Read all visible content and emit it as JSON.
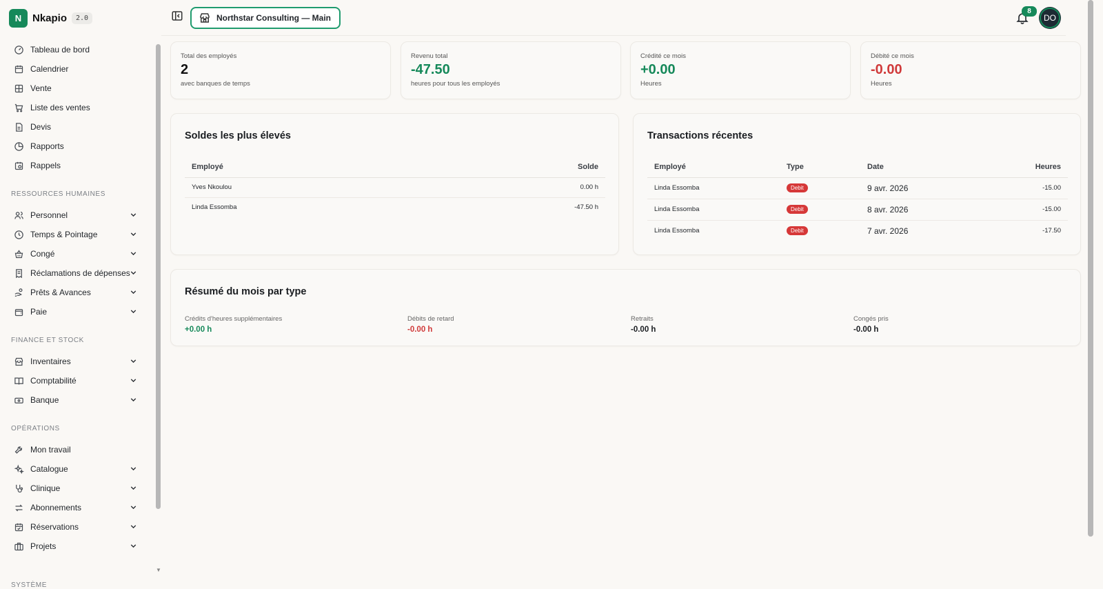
{
  "brand": {
    "logo_letter": "N",
    "name": "Nkapio",
    "version": "2.0"
  },
  "sidebar": {
    "top_items": [
      {
        "label": "Tableau de bord",
        "icon": "dashboard-gauge-icon"
      },
      {
        "label": "Calendrier",
        "icon": "calendar-icon"
      },
      {
        "label": "Vente",
        "icon": "grid-icon"
      },
      {
        "label": "Liste des ventes",
        "icon": "cart-icon"
      },
      {
        "label": "Devis",
        "icon": "document-icon"
      },
      {
        "label": "Rapports",
        "icon": "pie-chart-icon"
      },
      {
        "label": "Rappels",
        "icon": "calendar-clock-icon"
      }
    ],
    "sections": [
      {
        "title": "RESSOURCES HUMAINES",
        "items": [
          {
            "label": "Personnel",
            "icon": "users-icon"
          },
          {
            "label": "Temps & Pointage",
            "icon": "clock-icon"
          },
          {
            "label": "Congé",
            "icon": "beach-basket-icon"
          },
          {
            "label": "Réclamations de dépenses",
            "icon": "receipt-icon"
          },
          {
            "label": "Prêts & Avances",
            "icon": "hand-coins-icon"
          },
          {
            "label": "Paie",
            "icon": "wallet-icon"
          }
        ]
      },
      {
        "title": "FINANCE ET STOCK",
        "items": [
          {
            "label": "Inventaires",
            "icon": "store-icon"
          },
          {
            "label": "Comptabilité",
            "icon": "book-icon"
          },
          {
            "label": "Banque",
            "icon": "banknote-icon"
          }
        ]
      },
      {
        "title": "OPÉRATIONS",
        "items": [
          {
            "label": "Mon travail",
            "icon": "wrench-icon"
          },
          {
            "label": "Catalogue",
            "icon": "sparkles-icon"
          },
          {
            "label": "Clinique",
            "icon": "stethoscope-icon"
          },
          {
            "label": "Abonnements",
            "icon": "repeat-icon"
          },
          {
            "label": "Réservations",
            "icon": "calendar-check-icon"
          },
          {
            "label": "Projets",
            "icon": "briefcase-icon"
          }
        ]
      },
      {
        "title": "SYSTÈME",
        "items": []
      }
    ]
  },
  "header": {
    "store_name": "Northstar Consulting — Main",
    "notifications_count": "8",
    "avatar_initials": "DO"
  },
  "stats": [
    {
      "label": "Total des employés",
      "value": "2",
      "sub": "avec banques de temps",
      "color": "#111111"
    },
    {
      "label": "Revenu total",
      "value": "-47.50",
      "sub": "heures pour tous les employés",
      "color": "#16895a"
    },
    {
      "label": "Crédité ce mois",
      "value": "+0.00",
      "sub": "Heures",
      "color": "#16895a"
    },
    {
      "label": "Débité ce mois",
      "value": "-0.00",
      "sub": "Heures",
      "color": "#d03a3a"
    }
  ],
  "balances": {
    "title": "Soldes les plus élevés",
    "headers": {
      "employee": "Employé",
      "balance": "Solde"
    },
    "rows": [
      {
        "employee": "Yves Nkoulou",
        "balance": "0.00 h",
        "tone": "green"
      },
      {
        "employee": "Linda Essomba",
        "balance": "-47.50 h",
        "tone": "red"
      }
    ]
  },
  "transactions": {
    "title": "Transactions récentes",
    "headers": {
      "employee": "Employé",
      "type": "Type",
      "date": "Date",
      "hours": "Heures"
    },
    "rows": [
      {
        "employee": "Linda Essomba",
        "type": "Debit",
        "date": "9 avr. 2026",
        "hours": "-15.00"
      },
      {
        "employee": "Linda Essomba",
        "type": "Debit",
        "date": "8 avr. 2026",
        "hours": "-15.00"
      },
      {
        "employee": "Linda Essomba",
        "type": "Debit",
        "date": "7 avr. 2026",
        "hours": "-17.50"
      }
    ]
  },
  "summary": {
    "title": "Résumé du mois par type",
    "items": [
      {
        "label": "Crédits d'heures supplémentaires",
        "value": "+0.00 h",
        "tone": "green"
      },
      {
        "label": "Débits de retard",
        "value": "-0.00 h",
        "tone": "red"
      },
      {
        "label": "Retraits",
        "value": "-0.00 h",
        "tone": "dark"
      },
      {
        "label": "Congés pris",
        "value": "-0.00 h",
        "tone": "dark"
      }
    ]
  },
  "colors": {
    "accent": "#16895a",
    "danger": "#d03a3a",
    "background": "#faf8f5"
  }
}
